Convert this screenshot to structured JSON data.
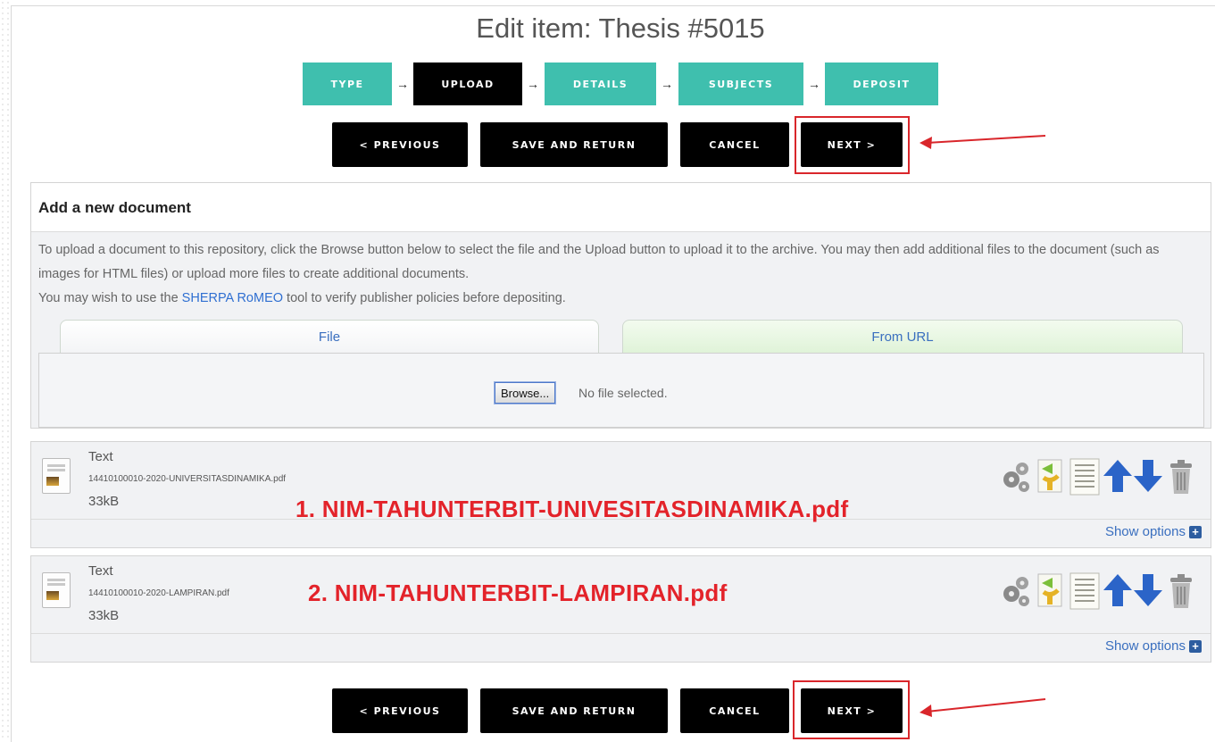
{
  "page": {
    "title": "Edit item: Thesis #5015"
  },
  "steps": [
    {
      "label": "TYPE",
      "active": false
    },
    {
      "label": "UPLOAD",
      "active": true
    },
    {
      "label": "DETAILS",
      "active": false
    },
    {
      "label": "SUBJECTS",
      "active": false
    },
    {
      "label": "DEPOSIT",
      "active": false
    }
  ],
  "step_arrow": "→",
  "nav": {
    "previous": "< PREVIOUS",
    "save_return": "SAVE AND RETURN",
    "cancel": "CANCEL",
    "next": "NEXT >"
  },
  "add_document": {
    "heading": "Add a new document",
    "info_line1": "To upload a document to this repository, click the Browse button below to select the file and the Upload button to upload it to the archive. You may then add additional files to the document (such as images for HTML files) or upload more files to create additional documents.",
    "info_line2_before": "You may wish to use the ",
    "info_link": "SHERPA RoMEO",
    "info_line2_after": " tool to verify publisher policies before depositing.",
    "tabs": {
      "file": "File",
      "url": "From URL"
    },
    "browse_button": "Browse...",
    "no_file": "No file selected."
  },
  "documents": [
    {
      "type": "Text",
      "filename": "14410100010-2020-UNIVERSITASDINAMIKA.pdf",
      "size": "33kB",
      "annotation": "1. NIM-TAHUNTERBIT-UNIVESITASDINAMIKA.pdf",
      "show_options": "Show options"
    },
    {
      "type": "Text",
      "filename": "14410100010-2020-LAMPIRAN.pdf",
      "size": "33kB",
      "annotation": "2. NIM-TAHUNTERBIT-LAMPIRAN.pdf",
      "show_options": "Show options"
    }
  ],
  "colors": {
    "step_inactive": "#3fbfae",
    "step_active": "#000000",
    "annotation_red": "#e3232a",
    "link_blue": "#2f6fd1"
  },
  "icons": [
    "gears-icon",
    "update-icon",
    "document-list-icon",
    "arrow-up-icon",
    "arrow-down-icon",
    "trash-icon"
  ]
}
